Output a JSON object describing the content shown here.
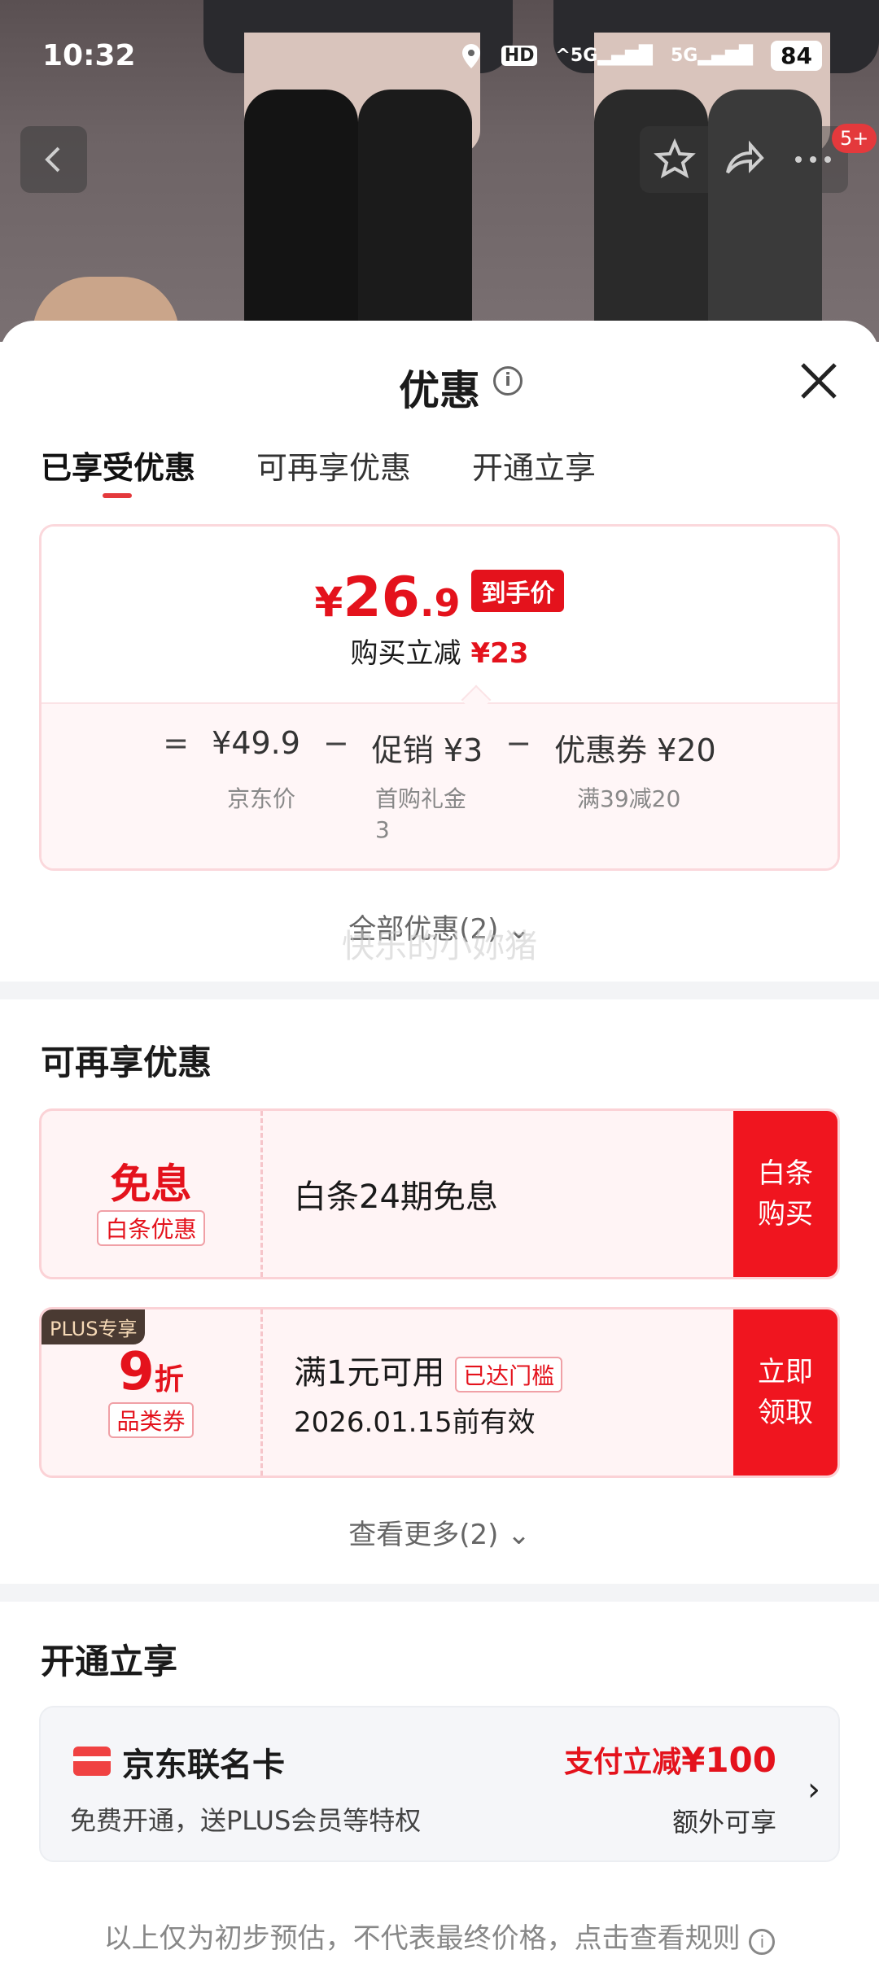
{
  "status_bar": {
    "time": "10:32",
    "hd": "HD",
    "sig1": "5G",
    "sig2": "5G",
    "battery": "84"
  },
  "top_nav": {
    "badge": "5+"
  },
  "sheet": {
    "title": "优惠",
    "tabs": [
      "已享受优惠",
      "可再享优惠",
      "开通立享"
    ],
    "price_box": {
      "currency": "¥",
      "final_int": "26",
      "final_dec": ".9",
      "final_tag": "到手价",
      "reduce_label": "购买立减",
      "reduce_value": "¥23",
      "formula": {
        "eq": "=",
        "jd_price": "¥49.9",
        "minus1": "−",
        "promo": "促销 ¥3",
        "minus2": "−",
        "coupon": "优惠券 ¥20"
      },
      "sub_jd": "京东价",
      "sub_promo": "首购礼金\n3",
      "sub_coupon": "满39减20"
    },
    "all_promo": "全部优惠(2)",
    "watermark": "快乐的小妳猪"
  },
  "more_section": {
    "title": "可再享优惠",
    "coupon1": {
      "big": "免息",
      "tag": "白条优惠",
      "text": "白条24期免息",
      "button": "白条\n购买"
    },
    "coupon2": {
      "plus": "PLUS专享",
      "big": "9",
      "unit": "折",
      "tag": "品类券",
      "text": "满1元可用",
      "badge": "已达门槛",
      "expire": "2026.01.15前有效",
      "button": "立即\n领取"
    },
    "see_more": "查看更多(2)"
  },
  "open_section": {
    "title": "开通立享",
    "card": {
      "name": "京东联名卡",
      "desc": "免费开通，送PLUS会员等特权",
      "pay_prefix": "支付立减",
      "pay_value": "¥100",
      "extra": "额外可享"
    }
  },
  "footer": "以上仅为初步预估，不代表最终价格，点击查看规则",
  "colors": {
    "brand_red": "#e4121c",
    "button_red": "#f0151f",
    "plus_brown": "#4a3a32"
  }
}
